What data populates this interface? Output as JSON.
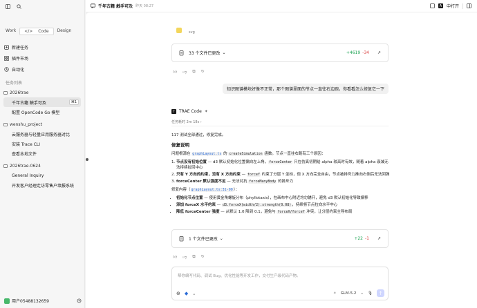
{
  "sidebar": {
    "mode_tabs": [
      "Work",
      "Code",
      "Design"
    ],
    "active_tab": "Code",
    "nav": [
      {
        "icon": "new-task-icon",
        "label": "新建任务"
      },
      {
        "icon": "plugin-icon",
        "label": "插件市场"
      },
      {
        "icon": "automation-icon",
        "label": "自动化"
      }
    ],
    "section_label": "任务列表",
    "projects": [
      {
        "name": "2026trae",
        "threads": [
          {
            "label": "千年古籍 触手可及",
            "selected": true,
            "shortcut": "⌘1"
          },
          {
            "label": "配置 OpenCode Go 模型"
          }
        ]
      },
      {
        "name": "wenshu_project",
        "threads": [
          {
            "label": "云服务器与轻量应用服务器对比"
          },
          {
            "label": "安装 Trace CLI"
          },
          {
            "label": "查看本地文件"
          }
        ]
      },
      {
        "name": "2026trae-0624",
        "threads": [
          {
            "label": "General Inquiry"
          },
          {
            "label": "开发客户经理走访零售户填报系统"
          }
        ]
      }
    ],
    "user": "用户05488132659"
  },
  "topbar": {
    "title": "千年古籍 触手可及",
    "time": "昨天 08:27",
    "open_in": "中打开"
  },
  "chat": {
    "file_label": "svg",
    "changes_card_1": {
      "label": "33 个文件已更改",
      "added": "+4619",
      "removed": "-34"
    },
    "user_message": "知识图谱模块好像不正常，那个图谱里面的节点一直往右边跑，你看看怎么修复它一下",
    "agent_name": "TRAE Code",
    "elapsed": "任务耗时 2m 18s",
    "summary": "117 测试全部通过，修复完成。",
    "heading": "修复说明",
    "intro_prefix": "问题根源在",
    "intro_file": "graphLayout.ts",
    "intro_mid": "的",
    "intro_fn": "createSimulation",
    "intro_suffix": "函数。节点一直往右跑有三个原因：",
    "causes": [
      {
        "parts": [
          "节点没有初始位置",
          " — d3 默认初始化位置偏向左上角，",
          "forceCenter",
          " 只在仿真初期给 alpha 较高时有效，随着 alpha 衰减无法持续拉回中心"
        ]
      },
      {
        "parts": [
          "只有 Y 方向的约束，没有 X 方向约束",
          " — ",
          "forceY",
          " 约束了分层 Y 坐标，但 X 方向完全自由，节点被排斥力推向右侧后无法回弹"
        ]
      },
      {
        "parts": [
          "forceCenter 默认强度不足",
          " — 无法对抗 ",
          "forceManyBody",
          " 的排斥力"
        ]
      }
    ],
    "fix_prefix": "修复内容（",
    "fix_link": "graphLayout.ts:31-90",
    "fix_suffix": "）：",
    "fixes": [
      {
        "parts": [
          "初始化节点位置",
          " — 使用黄金角螺旋分布（phyllotaxis），在画布中心附近均匀铺开，避免 d3 默认初始化导致偏移"
        ]
      },
      {
        "parts": [
          "添加 forceX 水平约束",
          " — ",
          "d3.forceX(width/2).strength(0.08)",
          "，持续将节点拉向水平中心"
        ]
      },
      {
        "parts": [
          "降低 forceCenter 强度",
          " — 从默认 1.0 降到 0.1，避免与 ",
          "forceX/forceY",
          " 冲突，让分层约束主导布局"
        ]
      }
    ],
    "changes_card_2": {
      "label": "1 个文件已更改",
      "added": "+22",
      "removed": "-1"
    }
  },
  "composer": {
    "placeholder": "帮你编写代码、调试 Bug、优化性能等开发工作，交付生产级代码产物。",
    "model": "GLM-5.2"
  }
}
